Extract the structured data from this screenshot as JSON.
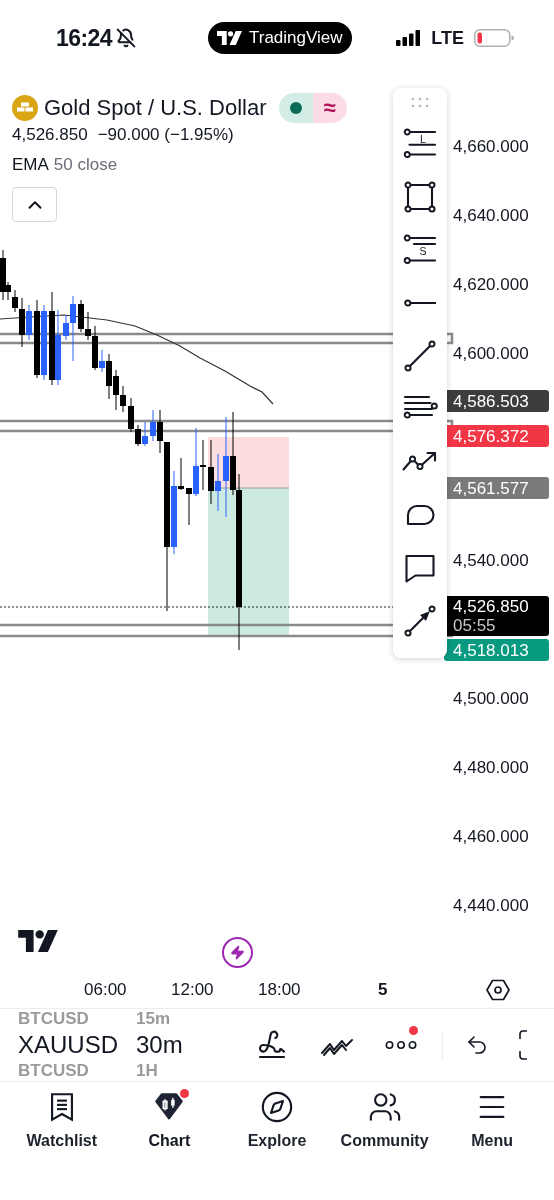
{
  "status_bar": {
    "time": "16:24",
    "app_pill": "TradingView",
    "network": "LTE"
  },
  "symbol_header": {
    "title": "Gold Spot / U.S. Dollar",
    "status_symbol": "≈",
    "price": "4,526.850",
    "change": "−90.000 (−1.95%)",
    "indicator": {
      "name": "EMA",
      "params": "50 close"
    }
  },
  "drawing_tools": [
    {
      "kind": "long",
      "letter": "L"
    },
    {
      "kind": "rectangle"
    },
    {
      "kind": "short",
      "letter": "S"
    },
    {
      "kind": "horizontal_ray"
    },
    {
      "kind": "trend_line"
    },
    {
      "kind": "channel"
    },
    {
      "kind": "path"
    },
    {
      "kind": "shape"
    },
    {
      "kind": "comment"
    },
    {
      "kind": "arrow"
    }
  ],
  "price_axis": [
    "4,660.000",
    "4,640.000",
    "4,620.000",
    "4,600.000",
    "4,540.000",
    "4,500.000",
    "4,480.000",
    "4,460.000",
    "4,440.000"
  ],
  "price_tags": [
    {
      "value": "4,586.503",
      "color": "#3d3d3d"
    },
    {
      "value": "4,576.372",
      "color": "#f23645"
    },
    {
      "value": "4,561.577",
      "color": "#7a7a7a"
    },
    {
      "value": "4,526.850",
      "sub": "05:55",
      "color": "#000000"
    },
    {
      "value": "4,518.013",
      "color": "#089981"
    }
  ],
  "time_axis": [
    {
      "label": "06:00",
      "bold": false
    },
    {
      "label": "12:00",
      "bold": false
    },
    {
      "label": "18:00",
      "bold": false
    },
    {
      "label": "5",
      "bold": true
    }
  ],
  "symbol_picker": {
    "above": {
      "symbol": "BTCUSD",
      "interval": "15m"
    },
    "current": {
      "symbol": "XAUUSD",
      "interval": "30m"
    },
    "below": {
      "symbol": "BTCUSD",
      "interval": "1H"
    }
  },
  "chart_toolbar": {
    "more_notification": true
  },
  "nav": [
    {
      "kind": "watchlist",
      "label": "Watchlist",
      "selected": false,
      "notification": false
    },
    {
      "kind": "chart",
      "label": "Chart",
      "selected": true,
      "notification": true
    },
    {
      "kind": "explore",
      "label": "Explore",
      "selected": false,
      "notification": false
    },
    {
      "kind": "community",
      "label": "Community",
      "selected": false,
      "notification": false
    },
    {
      "kind": "menu",
      "label": "Menu",
      "selected": false,
      "notification": false
    }
  ]
}
